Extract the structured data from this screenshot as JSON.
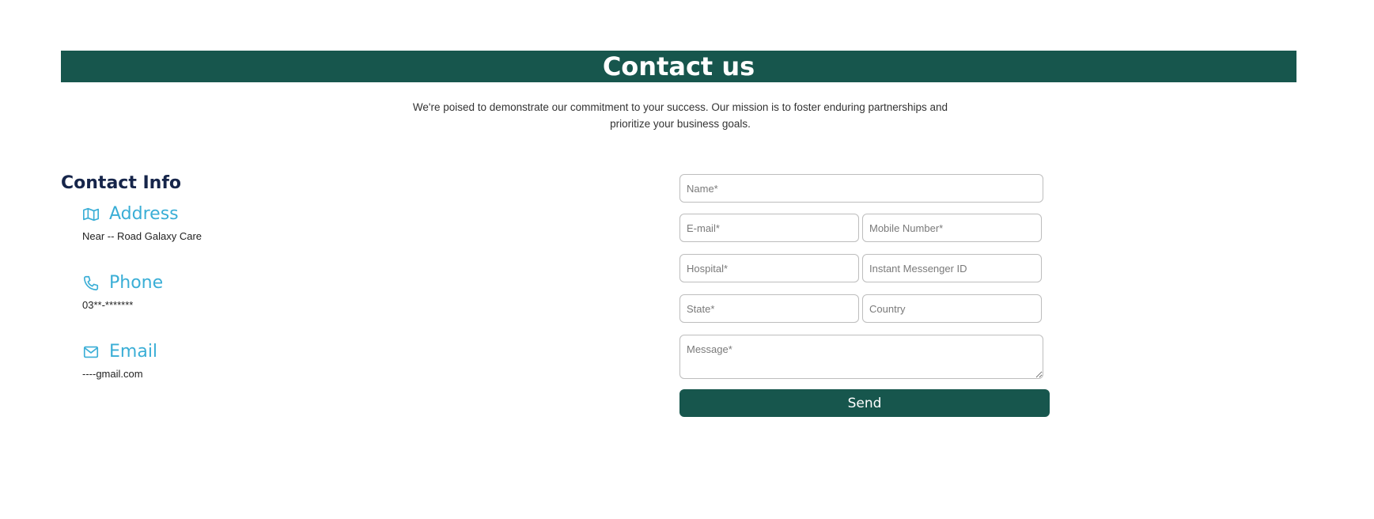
{
  "header": {
    "title": "Contact us",
    "subtitle": "We're poised to demonstrate our commitment to your success. Our mission is to foster enduring partnerships and prioritize your business goals."
  },
  "contact_info": {
    "heading": "Contact Info",
    "address": {
      "label": "Address",
      "value": "Near -- Road Galaxy Care",
      "icon": "map-icon"
    },
    "phone": {
      "label": "Phone",
      "value": "03**-*******",
      "icon": "phone-icon"
    },
    "email": {
      "label": "Email",
      "value": "----gmail.com",
      "icon": "mail-icon"
    }
  },
  "form": {
    "name_placeholder": "Name*",
    "email_placeholder": "E-mail*",
    "mobile_placeholder": "Mobile Number*",
    "hospital_placeholder": "Hospital*",
    "im_placeholder": "Instant Messenger ID",
    "state_placeholder": "State*",
    "country_placeholder": "Country",
    "message_placeholder": "Message*",
    "send_label": "Send"
  },
  "colors": {
    "brand": "#17564d",
    "accent": "#3aaed6",
    "heading": "#16254a"
  }
}
